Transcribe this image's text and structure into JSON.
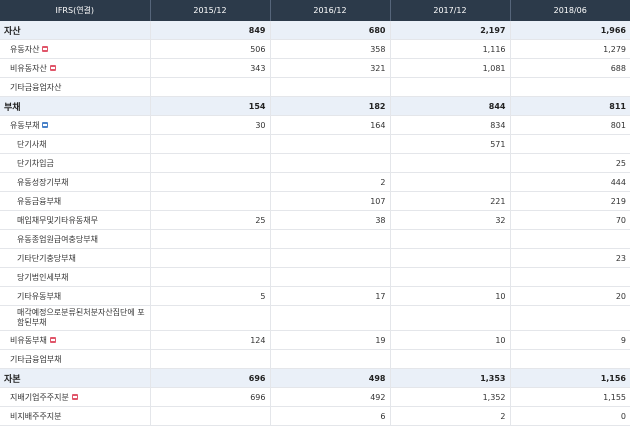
{
  "header": {
    "title": "IFRS(연결)",
    "periods": [
      "2015/12",
      "2016/12",
      "2017/12",
      "2018/06"
    ]
  },
  "rows": [
    {
      "label": "자산",
      "level": "section",
      "values": [
        "849",
        "680",
        "2,197",
        "1,966"
      ]
    },
    {
      "label": "유동자산",
      "level": "l1",
      "toggle": "plus",
      "values": [
        "506",
        "358",
        "1,116",
        "1,279"
      ]
    },
    {
      "label": "비유동자산",
      "level": "l1",
      "toggle": "plus",
      "values": [
        "343",
        "321",
        "1,081",
        "688"
      ]
    },
    {
      "label": "기타금융업자산",
      "level": "l1",
      "values": [
        "",
        "",
        "",
        ""
      ]
    },
    {
      "label": "부채",
      "level": "section",
      "values": [
        "154",
        "182",
        "844",
        "811"
      ]
    },
    {
      "label": "유동부채",
      "level": "l1",
      "toggle": "minus",
      "values": [
        "30",
        "164",
        "834",
        "801"
      ]
    },
    {
      "label": "단기사채",
      "level": "l2",
      "values": [
        "",
        "",
        "571",
        ""
      ]
    },
    {
      "label": "단기차입금",
      "level": "l2",
      "values": [
        "",
        "",
        "",
        "25"
      ]
    },
    {
      "label": "유동성장기부채",
      "level": "l2",
      "values": [
        "",
        "2",
        "",
        "444"
      ]
    },
    {
      "label": "유동금융부채",
      "level": "l2",
      "values": [
        "",
        "107",
        "221",
        "219"
      ]
    },
    {
      "label": "매입채무및기타유동채무",
      "level": "l2",
      "values": [
        "25",
        "38",
        "32",
        "70"
      ]
    },
    {
      "label": "유동종업원급여충당부채",
      "level": "l2",
      "values": [
        "",
        "",
        "",
        ""
      ]
    },
    {
      "label": "기타단기충당부채",
      "level": "l2",
      "values": [
        "",
        "",
        "",
        "23"
      ]
    },
    {
      "label": "당기법인세부채",
      "level": "l2",
      "values": [
        "",
        "",
        "",
        ""
      ]
    },
    {
      "label": "기타유동부채",
      "level": "l2",
      "values": [
        "5",
        "17",
        "10",
        "20"
      ]
    },
    {
      "label": "매각예정으로분류된처분자산집단에 포함된부채",
      "level": "l2w",
      "two": true,
      "values": [
        "",
        "",
        "",
        ""
      ]
    },
    {
      "label": "비유동부채",
      "level": "l1",
      "toggle": "plus",
      "values": [
        "124",
        "19",
        "10",
        "9"
      ]
    },
    {
      "label": "기타금융업부채",
      "level": "l1",
      "values": [
        "",
        "",
        "",
        ""
      ]
    },
    {
      "label": "자본",
      "level": "section",
      "values": [
        "696",
        "498",
        "1,353",
        "1,156"
      ]
    },
    {
      "label": "지배기업주주지분",
      "level": "l1",
      "toggle": "plus",
      "values": [
        "696",
        "492",
        "1,352",
        "1,155"
      ]
    },
    {
      "label": "비지배주주지분",
      "level": "l1",
      "values": [
        "",
        "6",
        "2",
        "0"
      ]
    }
  ]
}
